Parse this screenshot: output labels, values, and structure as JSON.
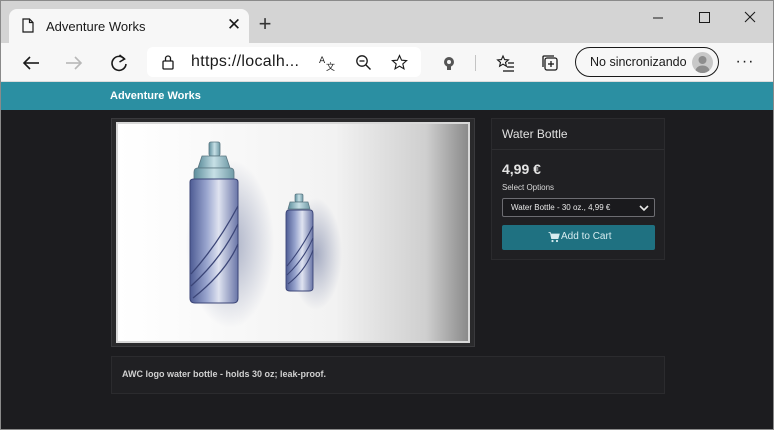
{
  "browser": {
    "tab": {
      "title": "Adventure Works",
      "icon": "document-icon"
    },
    "url": "https://localh...",
    "sync_label": "No sincronizando"
  },
  "site": {
    "brand": "Adventure Works",
    "accent_color": "#2b8fa2"
  },
  "product": {
    "name": "Water Bottle",
    "price": "4,99 €",
    "options_label": "Select Options",
    "selected_option": "Water Bottle - 30 oz., 4,99 €",
    "add_to_cart_label": "Add to Cart",
    "description": "AWC logo water bottle - holds 30 oz; leak-proof."
  }
}
